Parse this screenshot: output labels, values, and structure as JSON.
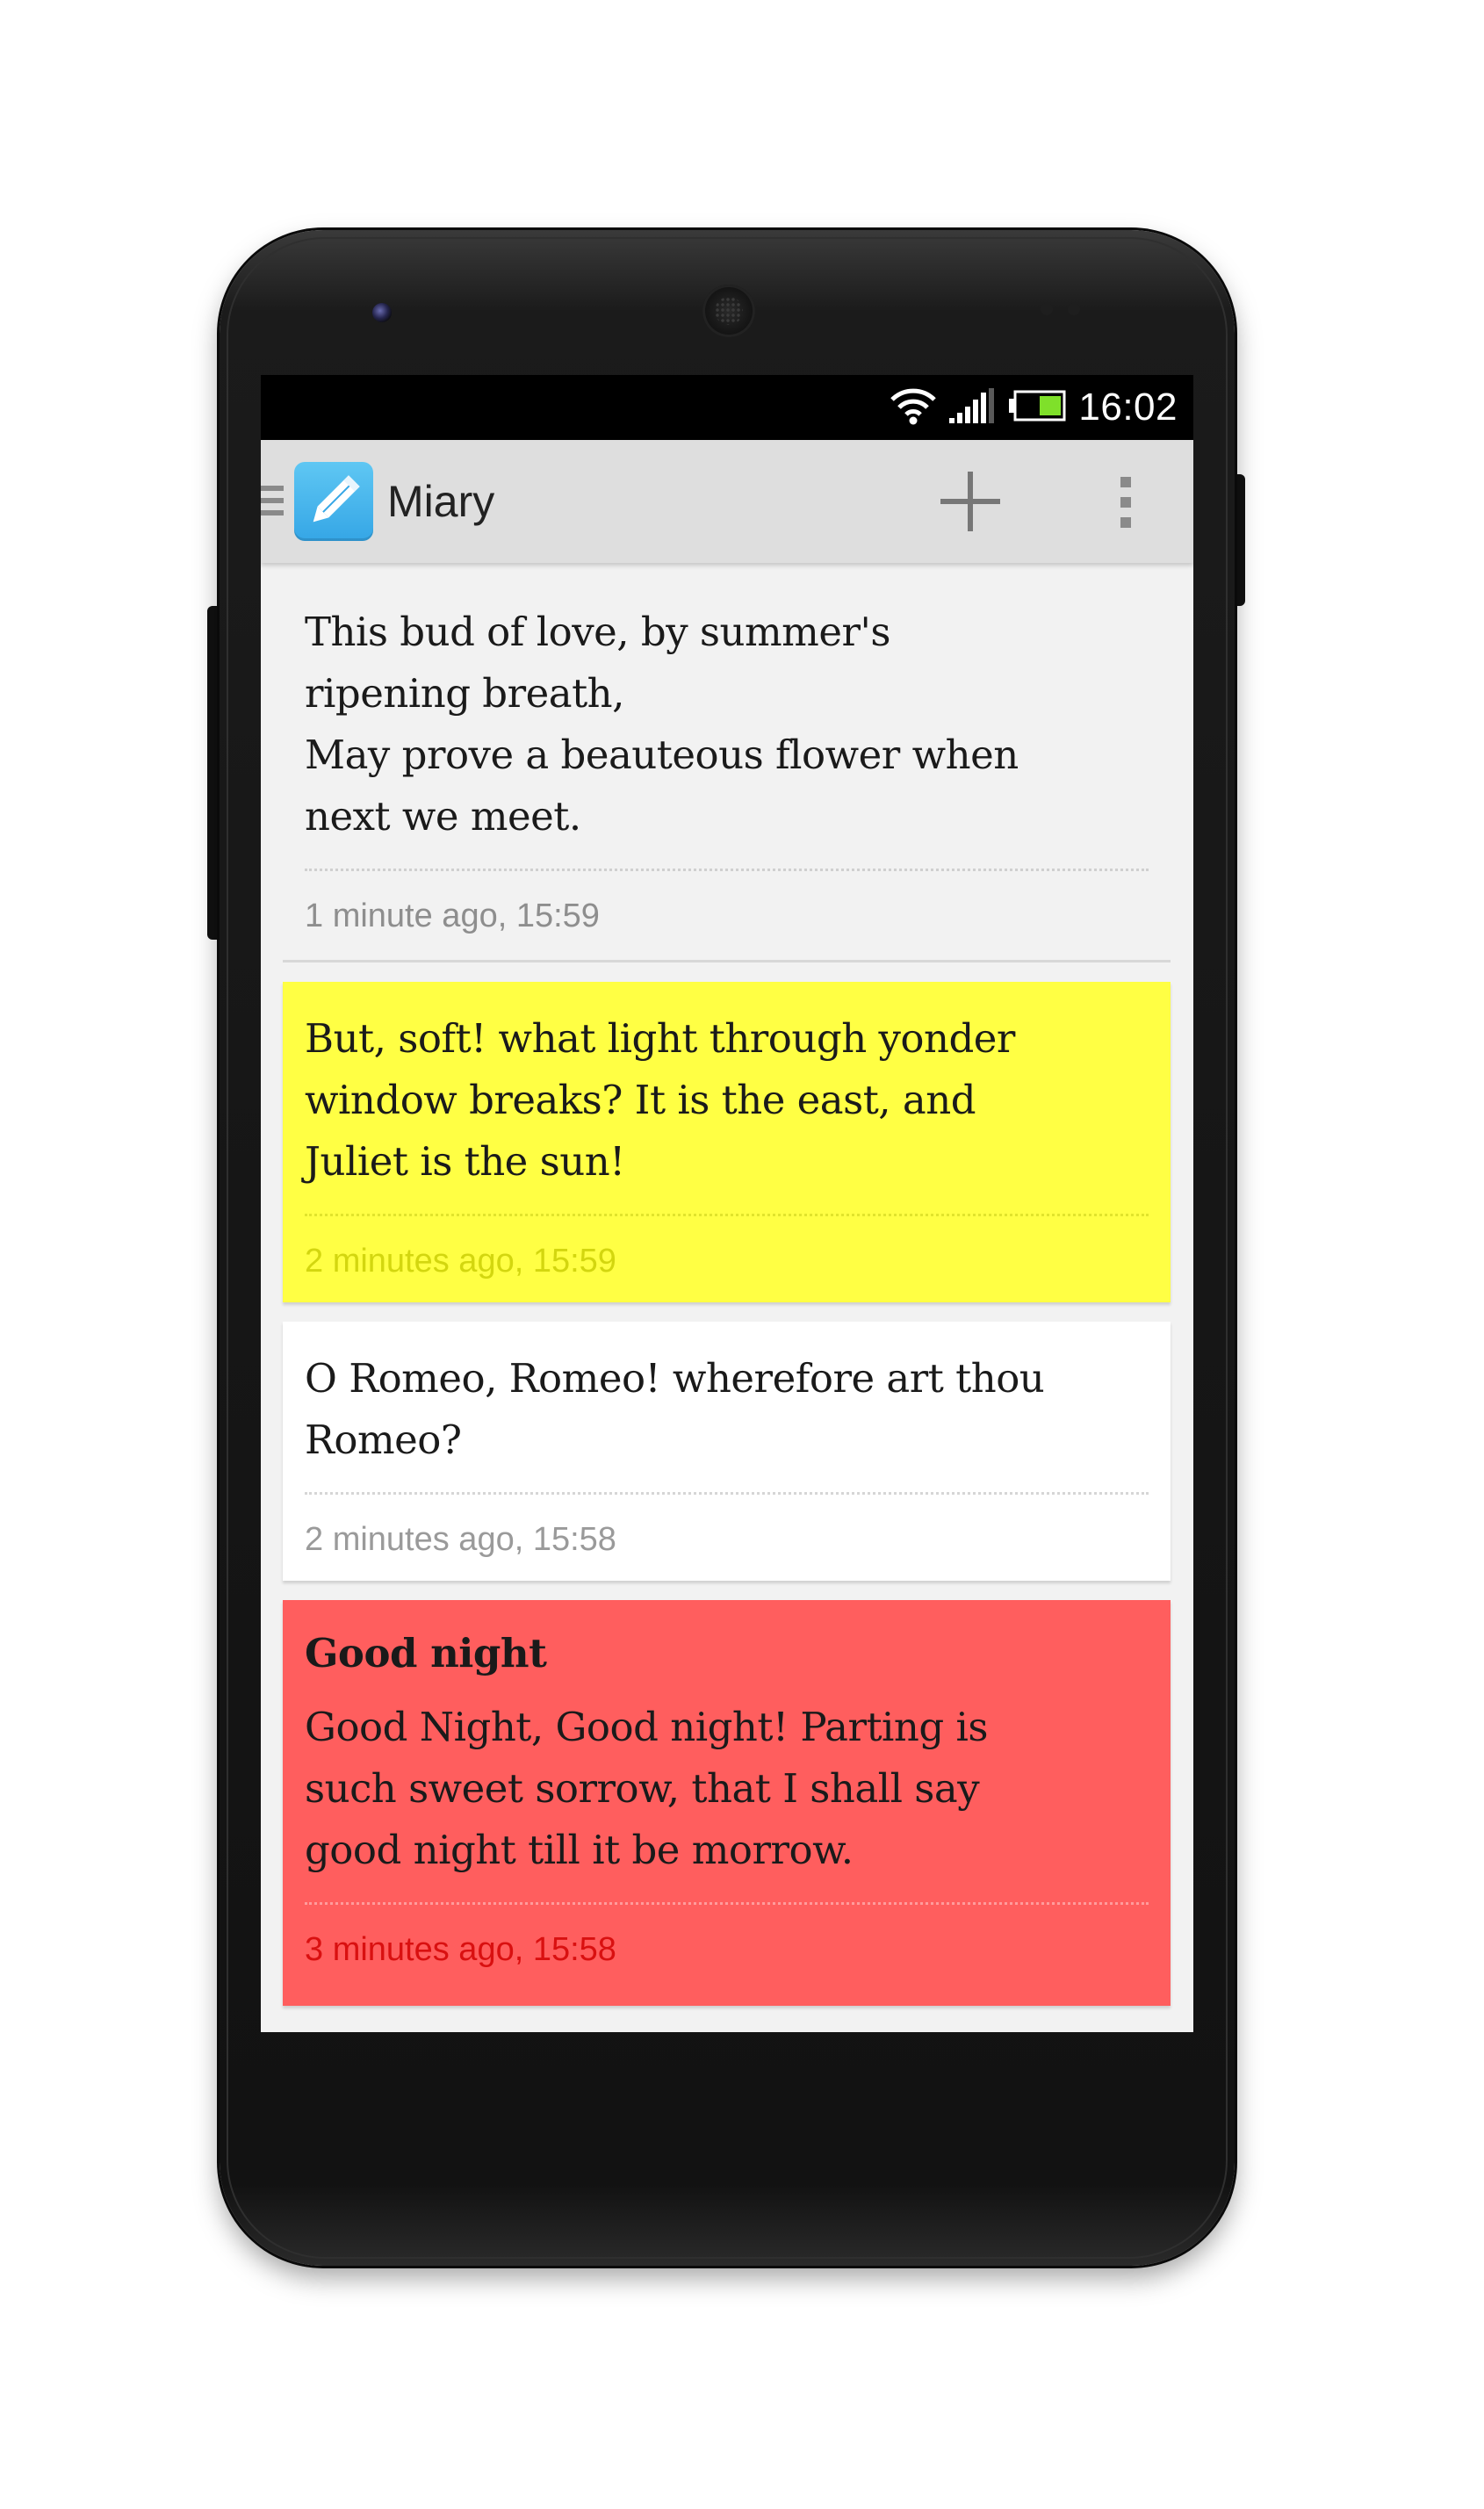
{
  "status_bar": {
    "time": "16:02",
    "icons": [
      "wifi-icon",
      "signal-icon",
      "battery-icon"
    ]
  },
  "action_bar": {
    "app_name": "Miary",
    "icons": {
      "drawer": "drawer-indicator-icon",
      "app": "pencil-icon",
      "add": "plus-icon",
      "overflow": "overflow-menu-icon"
    }
  },
  "notes": [
    {
      "title": "",
      "body": "This bud of love, by summer's\nripening breath,\nMay prove a beauteous flower when\nnext we meet.",
      "time": "1 minute ago, 15:59",
      "color": "#f2f2f2"
    },
    {
      "title": "",
      "body": "But, soft! what light through yonder\nwindow breaks? It is the east, and\nJuliet is the sun!",
      "time": "2 minutes ago, 15:59",
      "color": "#ffff44"
    },
    {
      "title": "",
      "body": "O Romeo, Romeo! wherefore art thou\nRomeo?",
      "time": "2 minutes ago, 15:58",
      "color": "#ffffff"
    },
    {
      "title": "Good night",
      "body": "Good Night, Good night! Parting is\nsuch sweet sorrow, that I shall say\ngood night till it be morrow.",
      "time": "3 minutes ago, 15:58",
      "color": "#ff5e5e"
    }
  ],
  "colors": {
    "app_icon": "#35a6e6",
    "action_bar": "#dedede",
    "status_bar": "#000000"
  }
}
